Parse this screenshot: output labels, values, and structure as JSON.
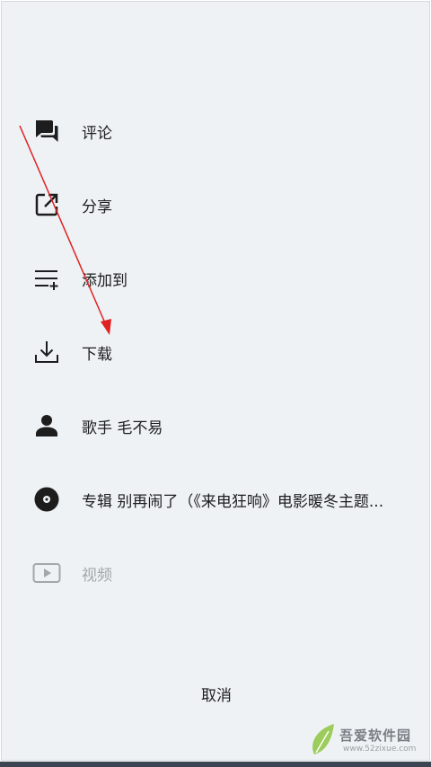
{
  "menu": {
    "items": [
      {
        "label": "评论",
        "icon": "comment-icon"
      },
      {
        "label": "分享",
        "icon": "share-icon"
      },
      {
        "label": "添加到",
        "icon": "add-to-playlist-icon"
      },
      {
        "label": "下载",
        "icon": "download-icon"
      },
      {
        "label": "歌手 毛不易",
        "icon": "artist-icon"
      },
      {
        "label": "专辑 别再闹了（《来电狂响》电影暖冬主题...",
        "icon": "album-disc-icon"
      },
      {
        "label": "视频",
        "icon": "video-play-icon",
        "disabled": true
      }
    ],
    "cancel_label": "取消"
  },
  "watermark": {
    "title": "吾爱软件园",
    "url": "www.52zixue.com"
  },
  "colors": {
    "background": "#eef2f5",
    "text": "#1d1d1d",
    "disabled_text": "#a3a7ab",
    "annotation_arrow": "#e02020"
  }
}
